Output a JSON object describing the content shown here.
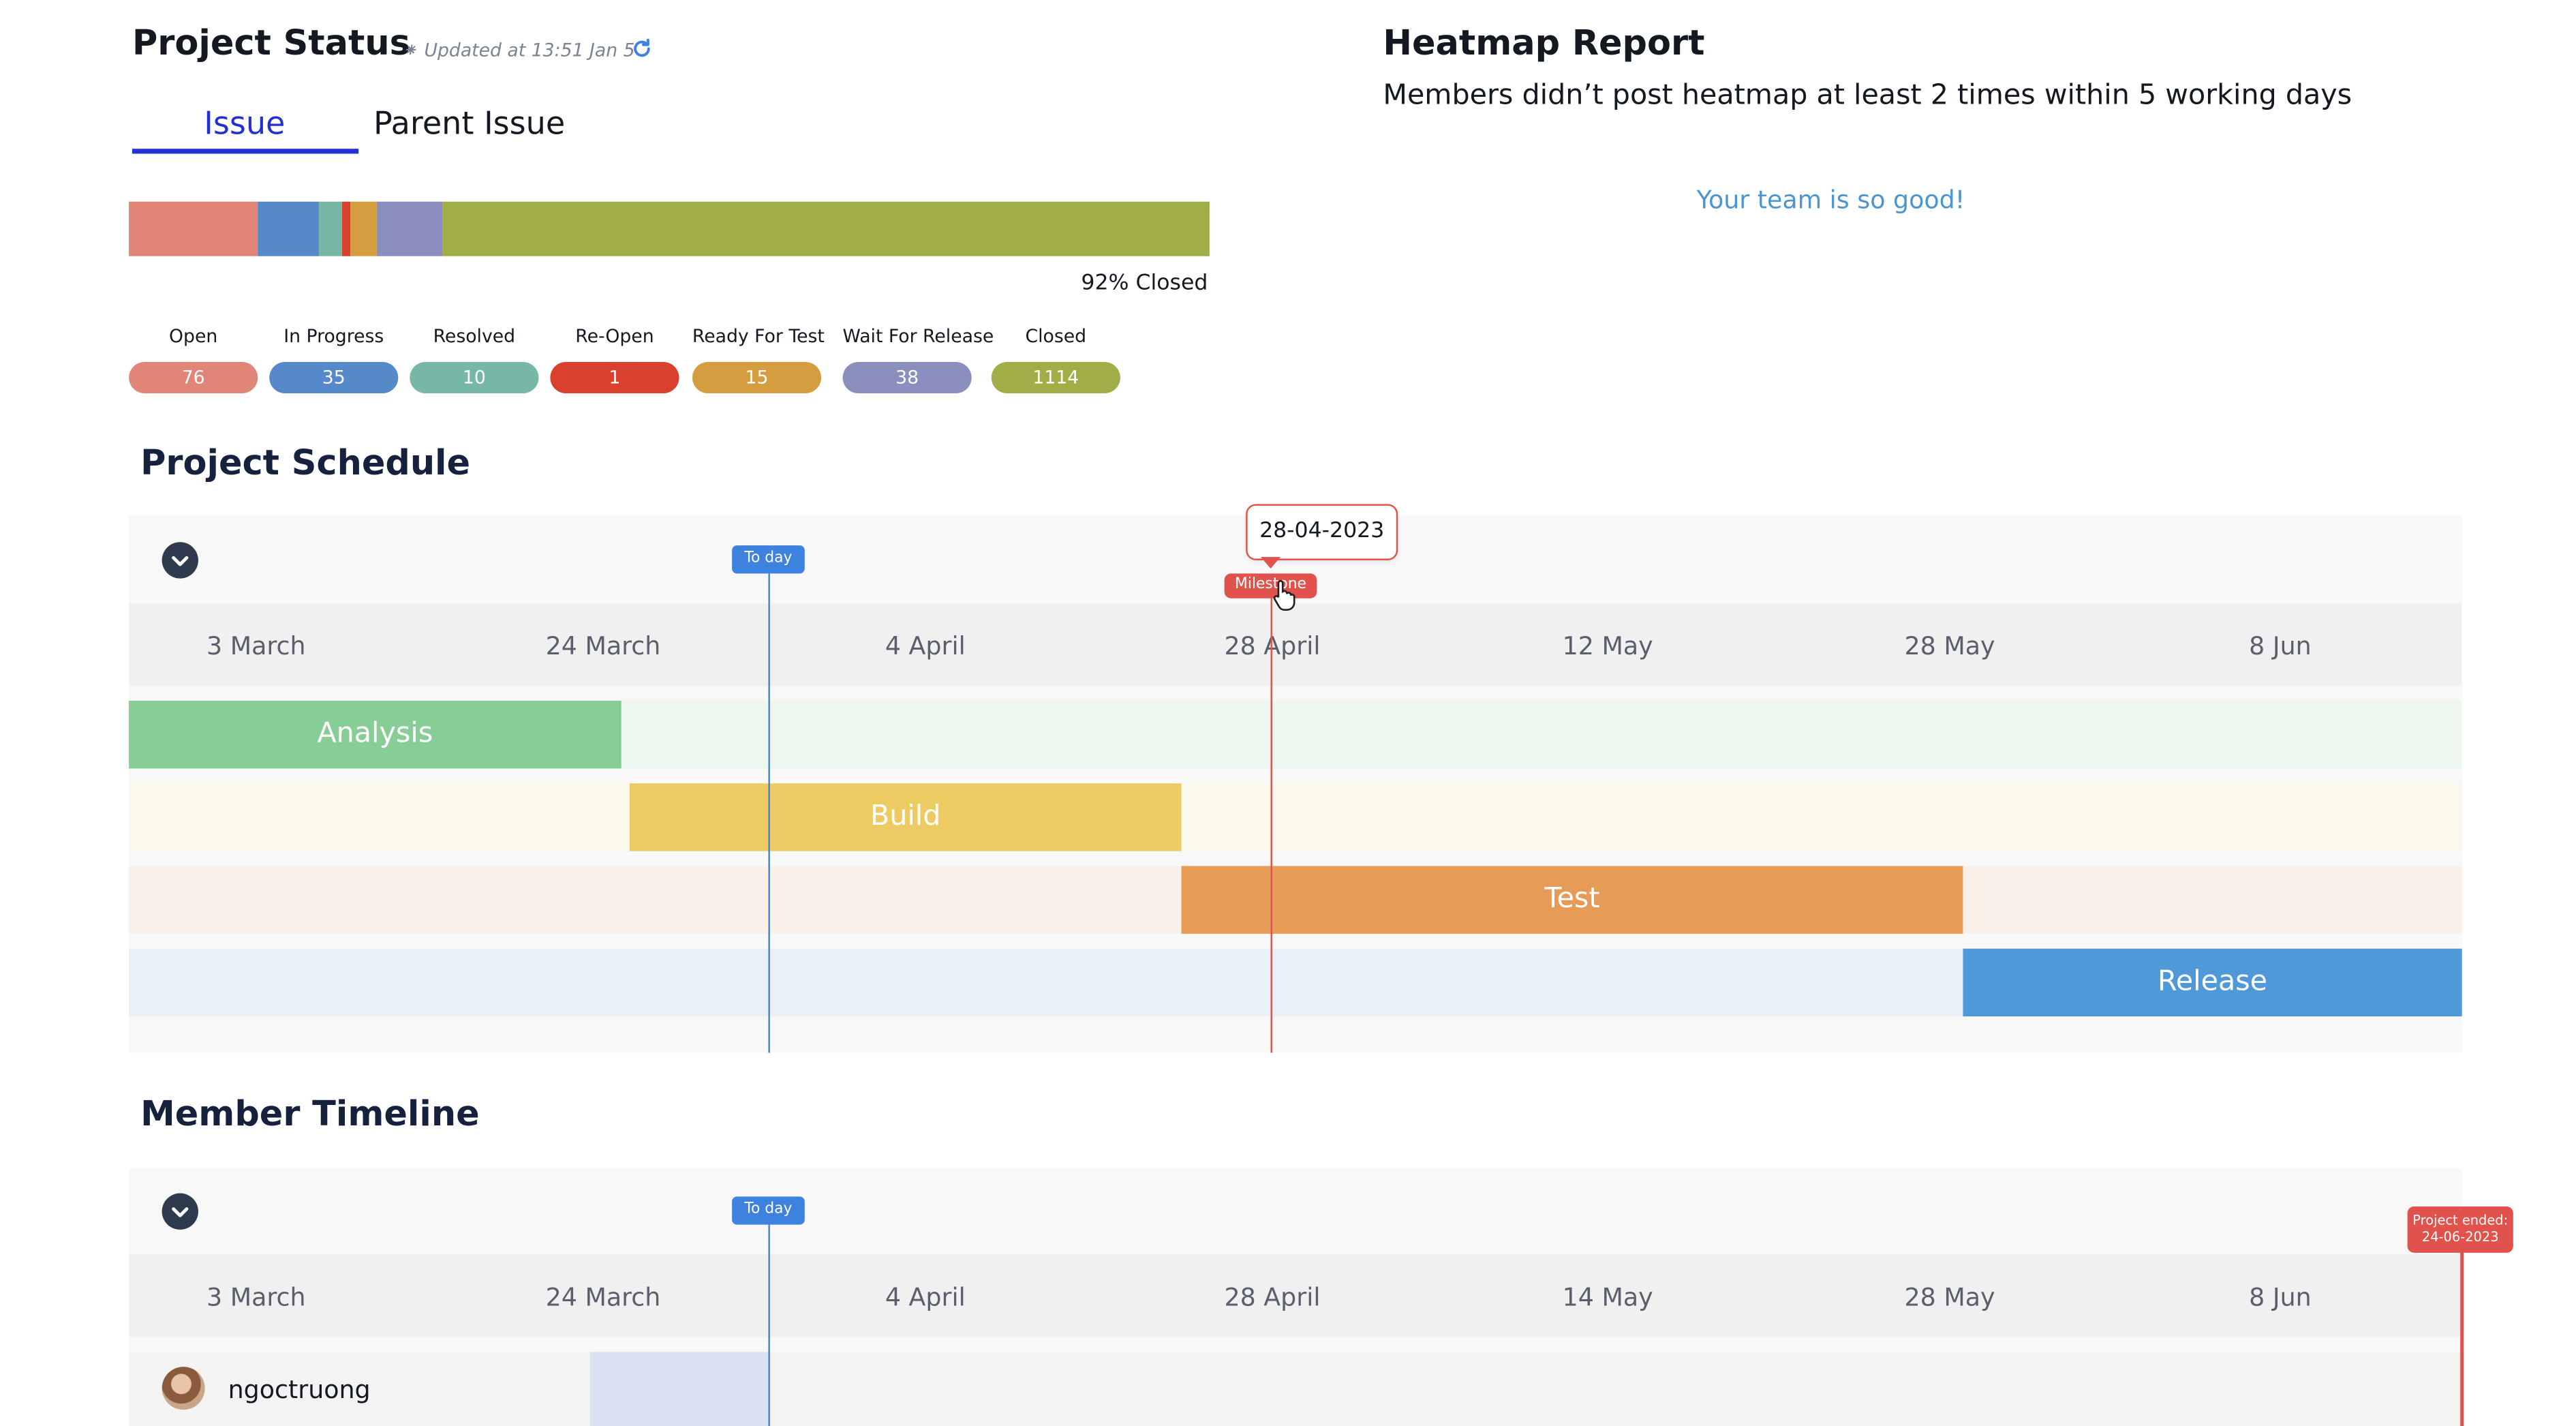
{
  "project_status": {
    "title": "Project Status",
    "updated": "Updated at 13:51 Jan 5",
    "refresh_icon": "refresh-icon",
    "tabs": [
      {
        "label": "Issue",
        "active": true
      },
      {
        "label": "Parent Issue",
        "active": false
      }
    ],
    "closed_summary": "92% Closed",
    "statuses": [
      {
        "label": "Open",
        "count": "76",
        "color": "#e08577"
      },
      {
        "label": "In Progress",
        "count": "35",
        "color": "#5689c9"
      },
      {
        "label": "Resolved",
        "count": "10",
        "color": "#77b7a5"
      },
      {
        "label": "Re-Open",
        "count": "1",
        "color": "#d9402d"
      },
      {
        "label": "Ready For Test",
        "count": "15",
        "color": "#d59d3f"
      },
      {
        "label": "Wait For Release",
        "count": "38",
        "color": "#8a8fbd"
      },
      {
        "label": "Closed",
        "count": "1114",
        "color": "#a1ae47"
      }
    ]
  },
  "heatmap": {
    "title": "Heatmap  Report",
    "subtitle": "Members didn’t post heatmap at least 2 times within 5 working days",
    "message": "Your team is so good!"
  },
  "project_schedule": {
    "title": "Project Schedule",
    "today_label": "To day",
    "milestone_label": "Milestone",
    "milestone_date": "28-04-2023",
    "dates": [
      "3 March",
      "24 March",
      "4 April",
      "28 April",
      "12 May",
      "28 May",
      "8 Jun"
    ],
    "phases": [
      {
        "label": "Analysis",
        "color": "#86cd96",
        "track": "#eef7ef"
      },
      {
        "label": "Build",
        "color": "#ebcb62",
        "track": "#fbf8ec"
      },
      {
        "label": "Test",
        "color": "#e69b57",
        "track": "#faf0ea"
      },
      {
        "label": "Release",
        "color": "#4f99d8",
        "track": "#eaf0f8"
      }
    ]
  },
  "member_timeline": {
    "title": "Member Timeline",
    "today_label": "To day",
    "project_ended_line1": "Project ended:",
    "project_ended_line2": "24-06-2023",
    "dates": [
      "3 March",
      "24 March",
      "4 April",
      "28 April",
      "14 May",
      "28 May",
      "8 Jun"
    ],
    "members": [
      {
        "name": "ngoctruong"
      }
    ]
  }
}
